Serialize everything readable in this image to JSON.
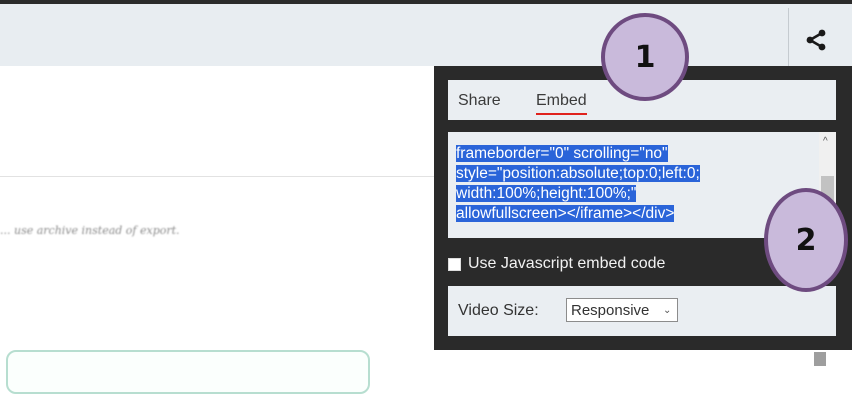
{
  "embed_panel": {
    "tabs": {
      "share_label": "Share",
      "embed_label": "Embed"
    },
    "embed_code_lines": [
      "frameborder=\"0\" scrolling=\"no\"",
      "style=\"position:absolute;top:0;left:0;",
      "width:100%;height:100%;\"",
      "allowfullscreen></iframe></div>"
    ],
    "javascript_option": {
      "label": "Use Javascript embed code",
      "checked": false
    },
    "video_size": {
      "label": "Video Size:",
      "selected": "Responsive"
    }
  },
  "page": {
    "blurred_note": "... use archive instead of export."
  },
  "annotations": {
    "badge_one": "1",
    "badge_two": "2"
  },
  "colors": {
    "tab_underline": "#e0221d",
    "selection": "#2a64d9",
    "badge_fill": "#c9badb",
    "badge_border": "#6e4b80",
    "panel_background": "#2a2a2a"
  }
}
